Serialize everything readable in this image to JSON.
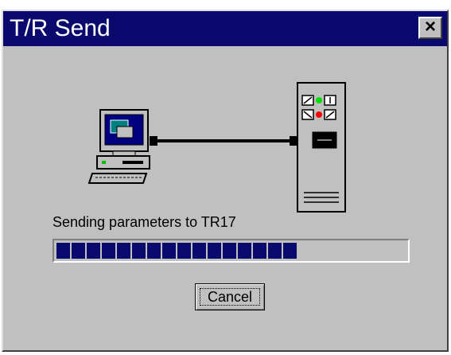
{
  "window": {
    "title": "T/R Send",
    "close_label": "×"
  },
  "status": {
    "message": "Sending parameters to TR17"
  },
  "progress": {
    "value_percent": 68,
    "filled_blocks": 16,
    "bar_color": "#0a0a6e"
  },
  "buttons": {
    "cancel_label": "Cancel"
  },
  "icons": {
    "computer": "computer-icon",
    "cable": "cable-icon",
    "device": "tr17-device-icon"
  },
  "colors": {
    "titlebar": "#0a0a6e",
    "face": "#c0c0c0",
    "led_green": "#00e000",
    "led_red": "#ff0000"
  }
}
